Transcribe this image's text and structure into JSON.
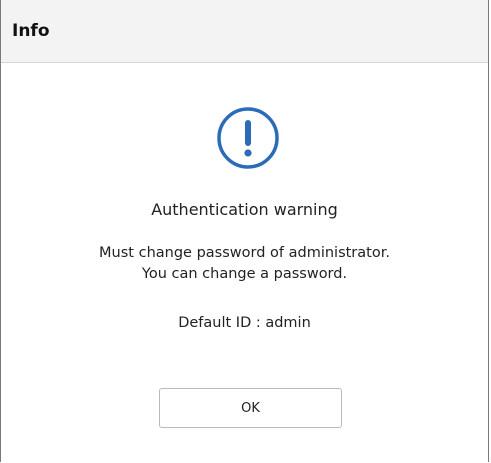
{
  "dialog": {
    "title": "Info",
    "icon": "exclamation-circle-icon",
    "accent_color": "#2b6cb8",
    "heading": "Authentication warning",
    "message_line1": "Must change password of administrator.",
    "message_line2": "You can change a password.",
    "default_id": "Default ID : admin",
    "ok_label": "OK"
  }
}
